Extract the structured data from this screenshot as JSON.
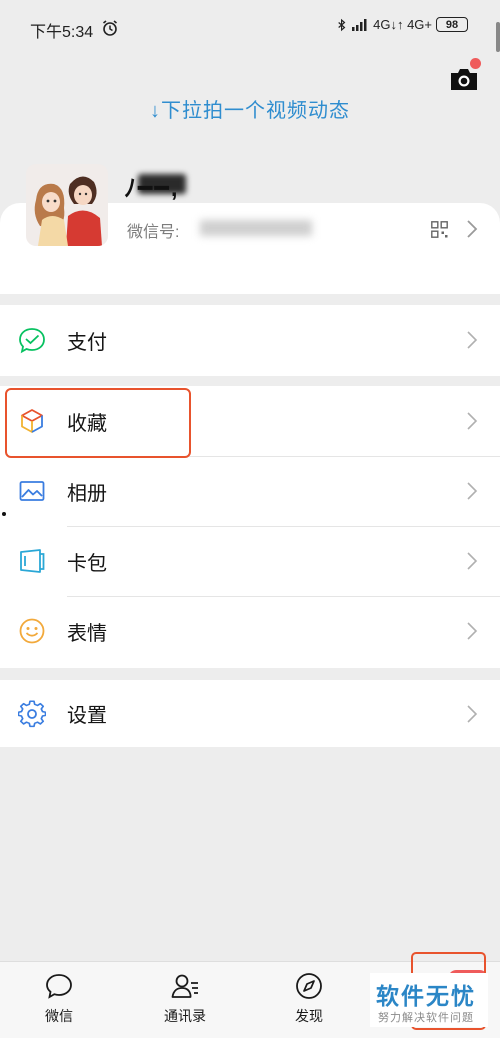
{
  "status_bar": {
    "time": "下午5:34",
    "network": "4G↓↑ 4G+",
    "battery": "98"
  },
  "header": {
    "pull_hint": "↓下拉拍一个视频动态"
  },
  "profile": {
    "nickname": "ﾉ━━,",
    "wechat_id_label": "微信号:",
    "wechat_id_value": ""
  },
  "menu": {
    "pay": "支付",
    "favorites": "收藏",
    "album": "相册",
    "cards": "卡包",
    "stickers": "表情",
    "settings": "设置"
  },
  "tabbar": {
    "chats": "微信",
    "contacts": "通讯录",
    "discover": "发现"
  },
  "watermark": {
    "title": "软件无忧",
    "subtitle": "努力解决软件问题"
  },
  "colors": {
    "accent_blue": "#2f8dcf",
    "highlight": "#e8532d",
    "green": "#07c160",
    "badge": "#ef5b5b"
  }
}
